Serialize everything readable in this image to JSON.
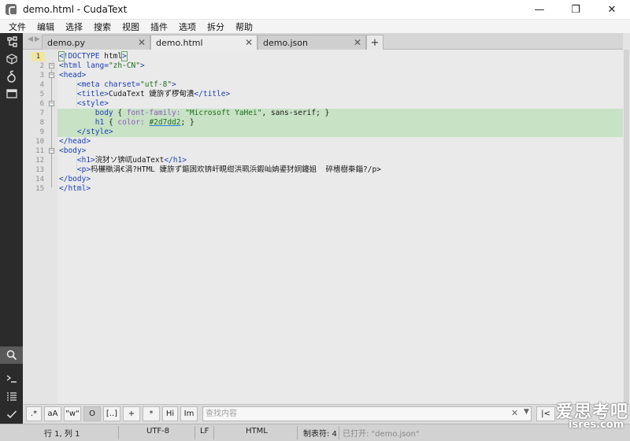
{
  "window": {
    "title": "demo.html - CudaText",
    "controls": {
      "minimize": "—",
      "maximize": "❐",
      "close": "✕"
    }
  },
  "menu": [
    "文件",
    "编辑",
    "选择",
    "搜索",
    "视图",
    "插件",
    "选项",
    "拆分",
    "帮助"
  ],
  "left_toolbar": {
    "top": [
      "tree-icon",
      "cube-icon",
      "delta-icon",
      "folder-panel-icon"
    ],
    "bottom": [
      "search-icon",
      "console-icon",
      "list-icon",
      "check-icon"
    ]
  },
  "tabs": [
    {
      "label": "demo.py",
      "close": "✕",
      "active": false
    },
    {
      "label": "demo.html",
      "close": "✕",
      "active": true
    },
    {
      "label": "demo.json",
      "close": "✕",
      "active": false
    }
  ],
  "tab_add": "+",
  "tab_arrows": "◀▶",
  "editor": {
    "current_line": 1,
    "lines": [
      {
        "n": "1",
        "text": "<!DOCTYPE html>"
      },
      {
        "n": "2",
        "text": "<html lang=\"zh-CN\">"
      },
      {
        "n": "3",
        "text": "<head>"
      },
      {
        "n": "4",
        "text": "    <meta charset=\"utf-8\">"
      },
      {
        "n": "5",
        "text": "    <title>CudaText 婕旂ず椤甸潰</title>"
      },
      {
        "n": "6",
        "text": "    <style>"
      },
      {
        "n": "7",
        "text": "        body { font-family: \"Microsoft YaHei\", sans-serif; }"
      },
      {
        "n": "8",
        "text": "        h1 { color: #2d7dd2; }"
      },
      {
        "n": "9",
        "text": "    </style>"
      },
      {
        "n": "10",
        "text": "</head>"
      },
      {
        "n": "11",
        "text": "<body>"
      },
      {
        "n": "12",
        "text": "    <h1>浣犲ソ锛屼udaText</h1>"
      },
      {
        "n": "13",
        "text": "    <p>杩欐槸涓€涓?HTML 婕旂ず鏂囦欢锛屽睍绀洪珮浜鍜屾姌鍙犲姛鑳姐  碎榰樹桊錙?/p>"
      },
      {
        "n": "14",
        "text": "</body>"
      },
      {
        "n": "15",
        "text": "</html>"
      }
    ],
    "highlight_color": "#c7e2c4",
    "css_color_value": "#2d7dd2"
  },
  "searchbar": {
    "buttons": [
      ".*",
      "aA",
      "\"w\"",
      "O",
      "[..]",
      "+",
      "*",
      "Hi",
      "Im"
    ],
    "placeholder": "查找内容",
    "clear": "✕",
    "dropdown": "▼",
    "nav": "|<"
  },
  "status": {
    "position": "行 1, 列 1",
    "encoding": "UTF-8",
    "line_ending": "LF",
    "lexer": "HTML",
    "tab": "制表符: 4",
    "message": "已打开: \"demo.json\""
  },
  "watermark": {
    "text": "爱思考吧",
    "url": "isres.com"
  }
}
